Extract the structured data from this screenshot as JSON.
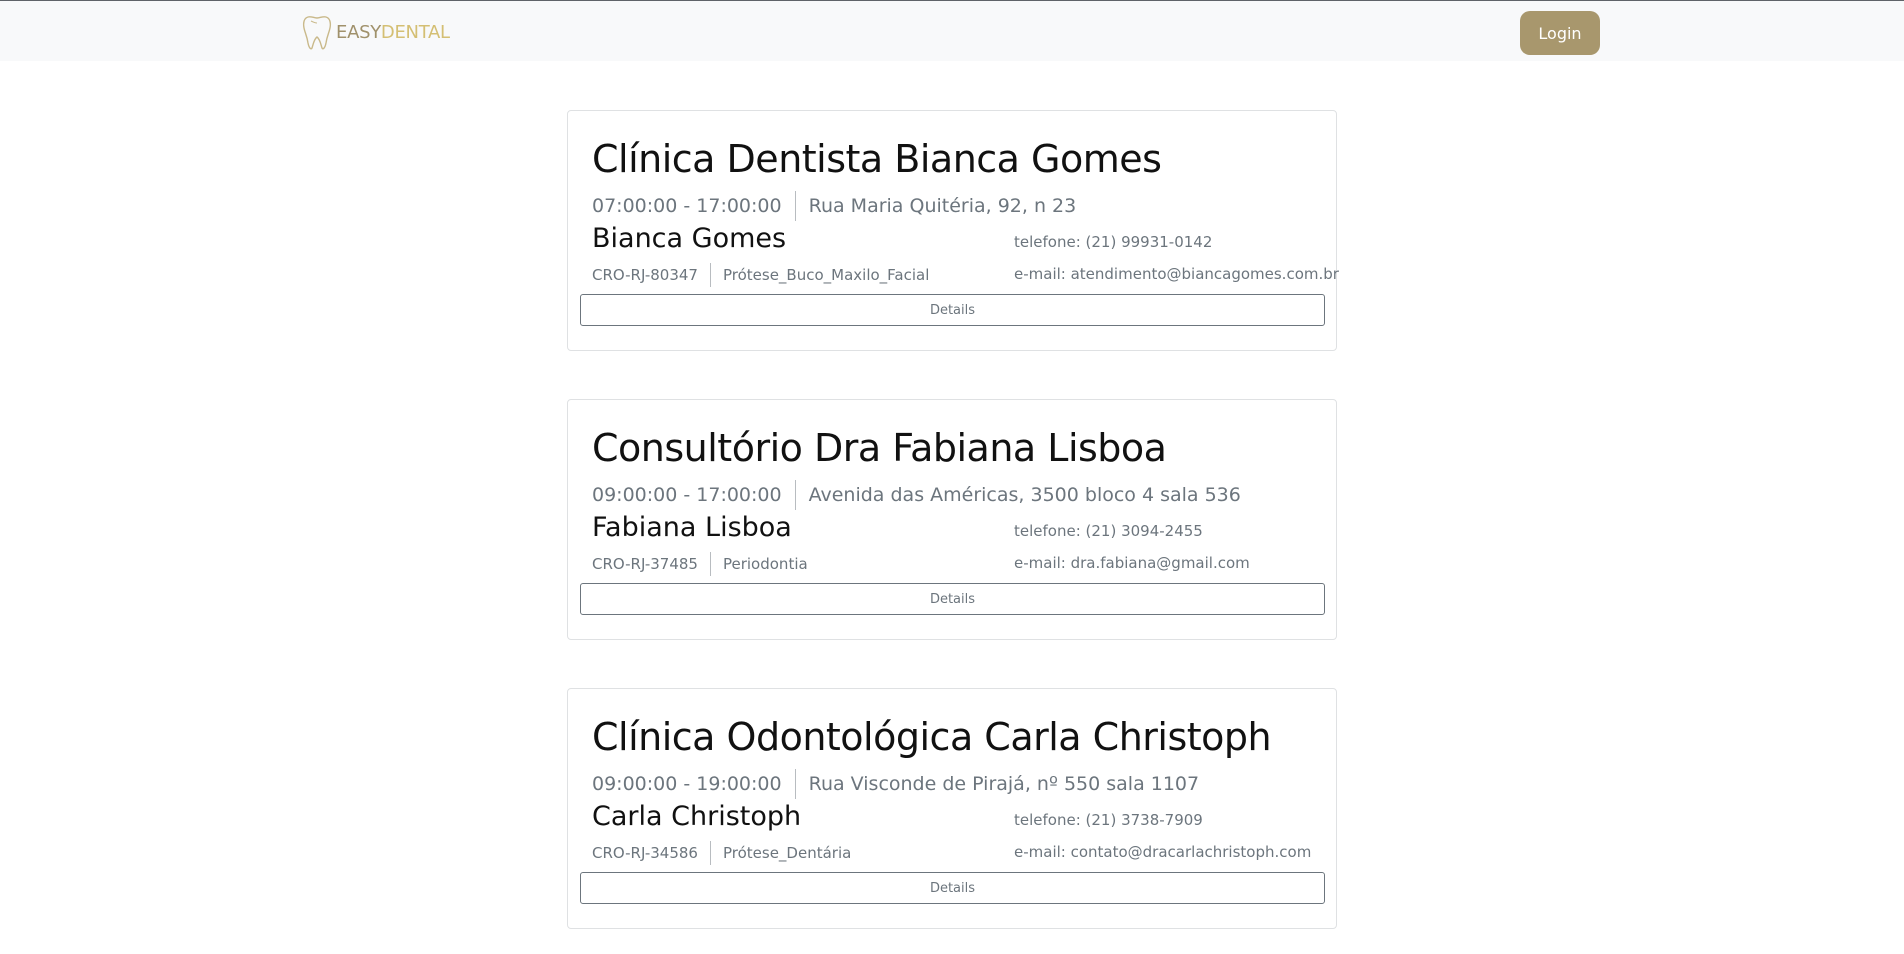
{
  "navbar": {
    "logo": {
      "part1": "EASY",
      "part2": "DENTAL"
    },
    "login_label": "Login"
  },
  "clinics": [
    {
      "name": "Clínica Dentista Bianca Gomes",
      "hours": "07:00:00 - 17:00:00",
      "address": "Rua Maria Quitéria, 92, n 23",
      "dentist": "Bianca Gomes",
      "phone": "telefone: (21) 99931-0142",
      "cro": "CRO-RJ-80347",
      "specialty": "Prótese_Buco_Maxilo_Facial",
      "email": "e-mail: atendimento@biancagomes.com.br",
      "details_label": "Details"
    },
    {
      "name": "Consultório Dra Fabiana Lisboa",
      "hours": "09:00:00 - 17:00:00",
      "address": "Avenida das Américas, 3500 bloco 4 sala 536",
      "dentist": "Fabiana Lisboa",
      "phone": "telefone: (21) 3094-2455",
      "cro": "CRO-RJ-37485",
      "specialty": "Periodontia",
      "email": "e-mail: dra.fabiana@gmail.com",
      "details_label": "Details"
    },
    {
      "name": "Clínica Odontológica Carla Christoph",
      "hours": "09:00:00 - 19:00:00",
      "address": "Rua Visconde de Pirajá, nº 550 sala 1107",
      "dentist": "Carla Christoph",
      "phone": "telefone: (21) 3738-7909",
      "cro": "CRO-RJ-34586",
      "specialty": "Prótese_Dentária",
      "email": "e-mail: contato@dracarlachristoph.com",
      "details_label": "Details"
    }
  ],
  "colors": {
    "accent": "#a8976d",
    "logo": "#a0916b",
    "muted_text": "#6c757d",
    "navbar_bg": "#f8f9fa"
  },
  "icons": {
    "logo": "tooth-icon"
  }
}
